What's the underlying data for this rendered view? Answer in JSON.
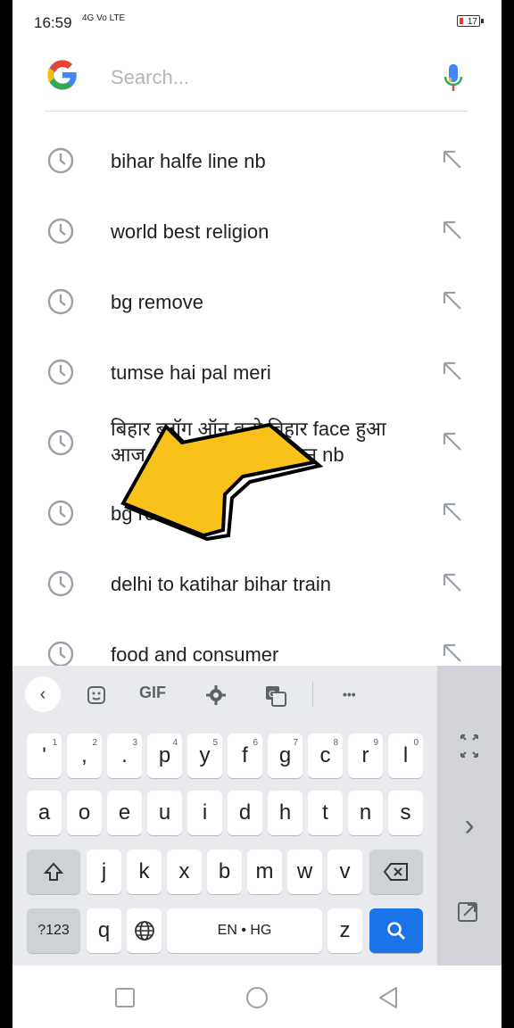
{
  "status_bar": {
    "time": "16:59",
    "network": "4G Vo LTE",
    "battery": "17",
    "battery_color": "#e53935"
  },
  "search": {
    "placeholder": "Search...",
    "value": "",
    "logo_icon": "google-logo-icon",
    "mic_icon": "mic-icon"
  },
  "suggestions": [
    {
      "text": "bihar halfe line nb"
    },
    {
      "text": "world best religion"
    },
    {
      "text": "bg remove"
    },
    {
      "text": "tumse hai pal meri"
    },
    {
      "text": "बिहार ब्लॉग ऑन करो बिहार face हुआ आज पटना बैठकी ऑन लाइन nb"
    },
    {
      "text": "bg remove"
    },
    {
      "text": "delhi to katihar bihar train"
    },
    {
      "text": "food and consumer"
    }
  ],
  "overlay": {
    "icon": "pointer-arrow-icon",
    "color": "#f9c21b"
  },
  "keyboard": {
    "toolbar": {
      "back": "‹",
      "sticker": "sticker-icon",
      "gif": "GIF",
      "settings": "gear-icon",
      "translate": "translate-icon",
      "more": "•••"
    },
    "row1": [
      {
        "key": "'",
        "sup": "1"
      },
      {
        "key": ",",
        "sup": "2"
      },
      {
        "key": ".",
        "sup": "3"
      },
      {
        "key": "p",
        "sup": "4"
      },
      {
        "key": "y",
        "sup": "5"
      },
      {
        "key": "f",
        "sup": "6"
      },
      {
        "key": "g",
        "sup": "7"
      },
      {
        "key": "c",
        "sup": "8"
      },
      {
        "key": "r",
        "sup": "9"
      },
      {
        "key": "l",
        "sup": "0"
      }
    ],
    "row2": [
      "a",
      "o",
      "e",
      "u",
      "i",
      "d",
      "h",
      "t",
      "n",
      "s"
    ],
    "row3": [
      "j",
      "k",
      "x",
      "b",
      "m",
      "w",
      "v"
    ],
    "row4": {
      "symbols": "?123",
      "q": "q",
      "space": "EN • HG",
      "z": "z"
    },
    "side": {
      "expand": "expand-icon",
      "next": "›",
      "float": "float-keyboard-icon"
    }
  },
  "navbar": {
    "recent": "square-icon",
    "home": "circle-icon",
    "back": "triangle-back-icon"
  }
}
